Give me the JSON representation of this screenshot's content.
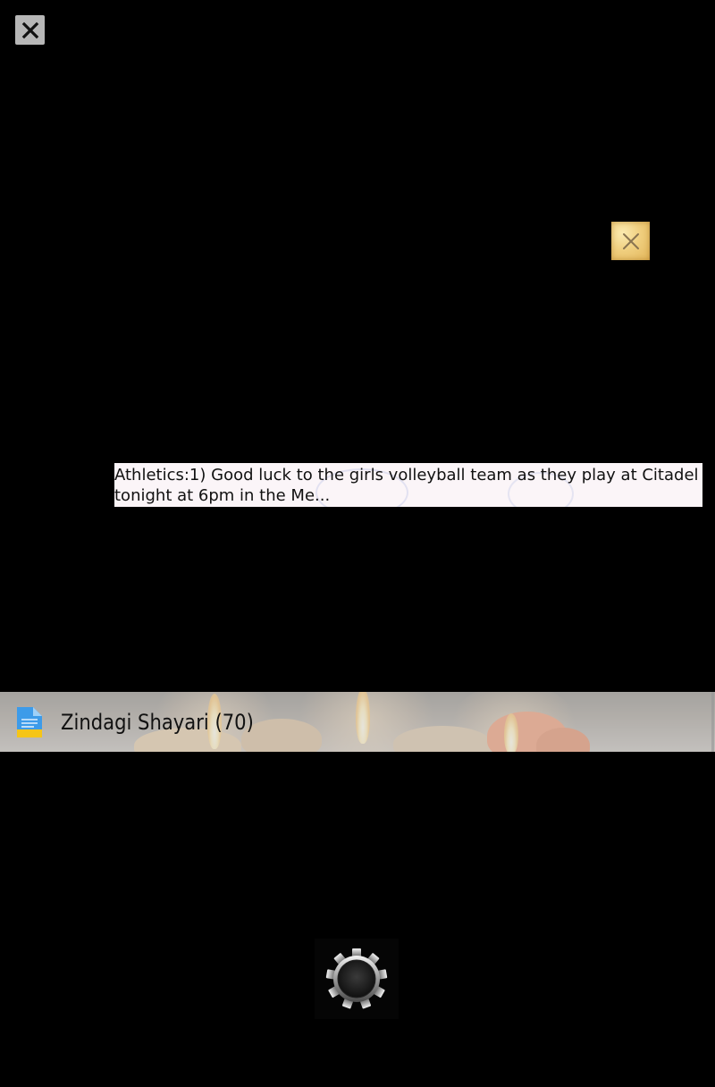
{
  "overlay": {
    "close_icon": "close-icon",
    "ad_close_icon": "close-icon"
  },
  "ticker": {
    "text": "Athletics:1) Good luck to the girls volleyball team as they play at Citadel tonight at 6pm in the Me..."
  },
  "list": {
    "items": [
      {
        "label": "Zindagi Shayari (70)",
        "icon": "document-icon"
      }
    ]
  },
  "footer": {
    "settings_icon": "gear-icon"
  },
  "colors": {
    "background": "#000000",
    "ticker_bg": "#fbf5f8",
    "doc_icon_blue": "#3d9be9",
    "doc_icon_yellow": "#f5c518"
  }
}
